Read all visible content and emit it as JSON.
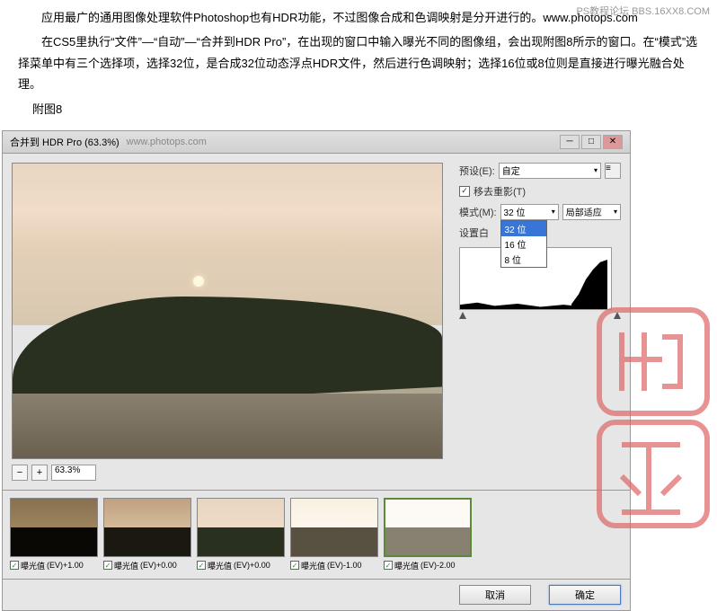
{
  "article": {
    "p1": "应用最广的通用图像处理软件Photoshop也有HDR功能，不过图像合成和色调映射是分开进行的。www.photops.com",
    "p2": "在CS5里执行“文件”—“自动”—“合并到HDR Pro”，在出现的窗口中输入曝光不同的图像组，会出现附图8所示的窗口。在“模式”选择菜单中有三个选择项，选择32位，是合成32位动态浮点HDR文件，然后进行色调映射；选择16位或8位则是直接进行曝光融合处理。",
    "caption": "附图8"
  },
  "watermarks": {
    "top_right": "PS教程论坛 BBS.16XX8.COM",
    "title_url": "www.photops.com"
  },
  "dialog": {
    "title": "合并到 HDR Pro (63.3%)",
    "preset_label": "预设(E):",
    "preset_value": "自定",
    "remove_ghost_label": "移去重影(T)",
    "mode_label": "模式(M):",
    "mode_value": "32 位",
    "mode_options": [
      "32 位",
      "16 位",
      "8 位"
    ],
    "local_adapt": "局部适应",
    "set_white_label": "设置白",
    "zoom_value": "63.3%",
    "cancel": "取消",
    "ok": "确定"
  },
  "thumbnails": [
    {
      "label": "曝光值",
      "ev": "(EV)+1.00"
    },
    {
      "label": "曝光值",
      "ev": "(EV)+0.00"
    },
    {
      "label": "曝光值",
      "ev": "(EV)+0.00"
    },
    {
      "label": "曝光值",
      "ev": "(EV)-1.00"
    },
    {
      "label": "曝光值",
      "ev": "(EV)-2.00"
    }
  ]
}
